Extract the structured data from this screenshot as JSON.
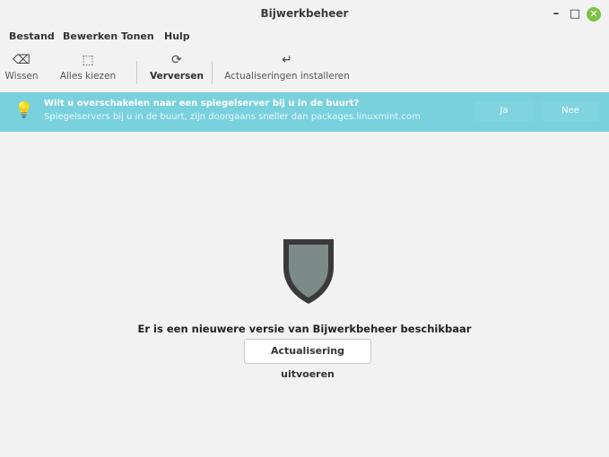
{
  "window": {
    "title": "Bijwerkbeheer",
    "controls": {
      "minimize": "–",
      "maximize": "□",
      "close": "✕"
    }
  },
  "menubar": [
    "Bestand",
    "Bewerken",
    "Tonen",
    "Hulp"
  ],
  "toolbar": {
    "clear": {
      "label": "Wissen",
      "icon": "backspace-icon"
    },
    "select_all": {
      "label": "Alles kiezen",
      "icon": "select-all-icon"
    },
    "refresh": {
      "label": "Verversen",
      "icon": "refresh-icon"
    },
    "install": {
      "label": "Actualiseringen installeren",
      "icon": "install-icon"
    }
  },
  "infobar": {
    "title": "Wilt u overschakelen naar een spiegelserver bij u in de buurt?",
    "subtitle": "Spiegelservers bij u in de buurt, zijn doorgaans sneller dan packages.linuxmint.com",
    "yes_label": "Ja",
    "no_label": "Nee",
    "icon": "lightbulb-icon"
  },
  "main": {
    "icon": "shield-icon",
    "message": "Er is een nieuwere versie van Bijwerkbeheer beschikbaar",
    "button_label": "Actualisering uitvoeren"
  },
  "colors": {
    "infobar_bg": "#79d1dd",
    "shield_fill": "#7d8b88",
    "shield_border": "#3a3a3a",
    "close_button": "#7dc242"
  }
}
